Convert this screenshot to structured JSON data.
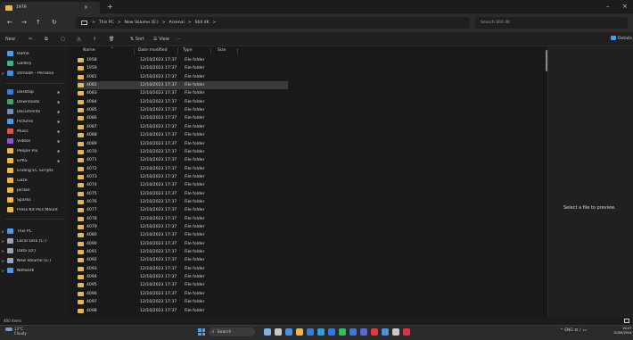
{
  "window": {
    "tab_title": "1979",
    "tab_close": "×",
    "tab_new": "+",
    "min": "–",
    "close": "×"
  },
  "nav": {
    "back": "←",
    "forward": "→",
    "up": "↑",
    "refresh": "↻"
  },
  "address": {
    "sep": ">",
    "crumbs": [
      "This PC",
      "New Volume (E:)",
      "Arsenal",
      "Still 4K"
    ]
  },
  "search": {
    "placeholder": "Search Still 4K"
  },
  "commands": {
    "new": "New",
    "sort": "Sort",
    "view": "View",
    "more": "···",
    "details": "Details"
  },
  "sidebar": {
    "items": [
      {
        "label": "Home",
        "icon": "home-icon",
        "color": "#4c9be8",
        "pinned": false,
        "chevron": ""
      },
      {
        "label": "Gallery",
        "icon": "gallery-icon",
        "color": "#3fb08a",
        "pinned": false,
        "chevron": ""
      },
      {
        "label": "shmooh - Persona",
        "icon": "cloud-icon",
        "color": "#3b8ed8",
        "pinned": false,
        "chevron": ">"
      },
      {
        "label": "Desktop",
        "icon": "desktop-icon",
        "color": "#3a7bd5",
        "pinned": true,
        "chevron": ""
      },
      {
        "label": "Downloads",
        "icon": "download-icon",
        "color": "#3fa36b",
        "pinned": true,
        "chevron": ""
      },
      {
        "label": "Documents",
        "icon": "document-icon",
        "color": "#6c8fb8",
        "pinned": true,
        "chevron": ""
      },
      {
        "label": "Pictures",
        "icon": "pictures-icon",
        "color": "#4c9be8",
        "pinned": true,
        "chevron": ""
      },
      {
        "label": "Music",
        "icon": "music-icon",
        "color": "#e0573d",
        "pinned": true,
        "chevron": ""
      },
      {
        "label": "Videos",
        "icon": "video-icon",
        "color": "#8a5bd6",
        "pinned": true,
        "chevron": ""
      },
      {
        "label": "People Pix",
        "icon": "folder-icon",
        "color": "#e8b84a",
        "pinned": true,
        "chevron": ""
      },
      {
        "label": "EPKS",
        "icon": "folder-icon",
        "color": "#e8b84a",
        "pinned": true,
        "chevron": ""
      },
      {
        "label": "Ending EC Scripts",
        "icon": "folder-icon",
        "color": "#e8b84a",
        "pinned": false,
        "chevron": ""
      },
      {
        "label": "Gaze",
        "icon": "folder-icon",
        "color": "#e8b84a",
        "pinned": false,
        "chevron": ""
      },
      {
        "label": "Jordan",
        "icon": "folder-icon",
        "color": "#e8b84a",
        "pinned": false,
        "chevron": ""
      },
      {
        "label": "Sparks",
        "icon": "folder-icon",
        "color": "#e8b84a",
        "pinned": false,
        "chevron": ""
      },
      {
        "label": "Press Kit Pics Mount",
        "icon": "folder-icon",
        "color": "#e8b84a",
        "pinned": false,
        "chevron": ""
      },
      {
        "label": "This PC",
        "icon": "pc-icon",
        "color": "#4c9be8",
        "pinned": false,
        "chevron": "v"
      },
      {
        "label": "Local Disk (C:)",
        "icon": "drive-icon",
        "color": "#9aa4b2",
        "pinned": false,
        "chevron": ">"
      },
      {
        "label": "Data (D:)",
        "icon": "drive-icon",
        "color": "#9aa4b2",
        "pinned": false,
        "chevron": ">"
      },
      {
        "label": "New Volume (E:)",
        "icon": "drive-icon",
        "color": "#9aa4b2",
        "pinned": false,
        "chevron": ">"
      },
      {
        "label": "Network",
        "icon": "network-icon",
        "color": "#4c9be8",
        "pinned": false,
        "chevron": ">"
      }
    ]
  },
  "columns": {
    "name": "Name",
    "date": "Date modified",
    "type": "Type",
    "size": "Size"
  },
  "files": [
    {
      "name": "1958",
      "date": "12/10/2023 17:37",
      "type": "File folder"
    },
    {
      "name": "1959",
      "date": "12/10/2023 17:37",
      "type": "File folder"
    },
    {
      "name": "4081",
      "date": "12/10/2023 17:37",
      "type": "File folder"
    },
    {
      "name": "4082",
      "date": "12/10/2023 17:37",
      "type": "File folder",
      "selected": true
    },
    {
      "name": "4083",
      "date": "12/10/2023 17:37",
      "type": "File folder"
    },
    {
      "name": "4084",
      "date": "12/10/2023 17:37",
      "type": "File folder"
    },
    {
      "name": "4085",
      "date": "12/10/2023 17:37",
      "type": "File folder"
    },
    {
      "name": "4086",
      "date": "12/10/2023 17:37",
      "type": "File folder"
    },
    {
      "name": "4087",
      "date": "12/10/2023 17:37",
      "type": "File folder"
    },
    {
      "name": "4088",
      "date": "12/10/2023 17:37",
      "type": "File folder"
    },
    {
      "name": "4089",
      "date": "12/10/2023 17:37",
      "type": "File folder"
    },
    {
      "name": "4070",
      "date": "12/10/2023 17:37",
      "type": "File folder"
    },
    {
      "name": "4071",
      "date": "12/10/2023 17:37",
      "type": "File folder"
    },
    {
      "name": "4072",
      "date": "12/10/2023 17:37",
      "type": "File folder"
    },
    {
      "name": "4073",
      "date": "12/10/2023 17:37",
      "type": "File folder"
    },
    {
      "name": "4074",
      "date": "12/10/2023 17:37",
      "type": "File folder"
    },
    {
      "name": "4075",
      "date": "12/10/2023 17:37",
      "type": "File folder"
    },
    {
      "name": "4076",
      "date": "12/10/2023 17:37",
      "type": "File folder"
    },
    {
      "name": "4077",
      "date": "12/10/2023 17:37",
      "type": "File folder"
    },
    {
      "name": "4078",
      "date": "12/10/2023 17:37",
      "type": "File folder"
    },
    {
      "name": "4079",
      "date": "12/10/2023 17:37",
      "type": "File folder"
    },
    {
      "name": "4080",
      "date": "12/10/2023 17:37",
      "type": "File folder"
    },
    {
      "name": "4090",
      "date": "12/10/2023 17:37",
      "type": "File folder"
    },
    {
      "name": "4091",
      "date": "12/10/2023 17:37",
      "type": "File folder"
    },
    {
      "name": "4092",
      "date": "12/10/2023 17:37",
      "type": "File folder"
    },
    {
      "name": "4093",
      "date": "12/10/2023 17:37",
      "type": "File folder"
    },
    {
      "name": "4094",
      "date": "12/10/2023 17:37",
      "type": "File folder"
    },
    {
      "name": "4095",
      "date": "12/10/2023 17:37",
      "type": "File folder"
    },
    {
      "name": "4096",
      "date": "12/10/2023 17:37",
      "type": "File folder"
    },
    {
      "name": "4097",
      "date": "12/10/2023 17:37",
      "type": "File folder"
    },
    {
      "name": "4098",
      "date": "12/10/2023 17:37",
      "type": "File folder"
    }
  ],
  "preview": {
    "message": "Select a file to preview."
  },
  "status": {
    "items": "400 items"
  },
  "taskbar": {
    "weather_temp": "13°C",
    "weather_desc": "Cloudy",
    "search": "Search",
    "apps": [
      {
        "icon": "copilot-icon",
        "color": "#7fb0e0"
      },
      {
        "icon": "task-view-icon",
        "color": "#c8c8c8"
      },
      {
        "icon": "chrome-icon",
        "color": "#4a8fe0"
      },
      {
        "icon": "file-explorer-icon",
        "color": "#e8b84a"
      },
      {
        "icon": "store-icon",
        "color": "#3a7bd5"
      },
      {
        "icon": "edge-icon",
        "color": "#2fa0d8"
      },
      {
        "icon": "photoshop-icon",
        "color": "#2c7be0"
      },
      {
        "icon": "spotify-icon",
        "color": "#2ec060"
      },
      {
        "icon": "outlook-icon",
        "color": "#3a7bd5"
      },
      {
        "icon": "app-icon",
        "color": "#5a6ad8"
      },
      {
        "icon": "netflix-icon",
        "color": "#e03a3a"
      },
      {
        "icon": "app-icon",
        "color": "#4a8fe0"
      },
      {
        "icon": "app-icon",
        "color": "#c8c8c8"
      },
      {
        "icon": "app-icon",
        "color": "#e0304a"
      }
    ],
    "tray": "^  ENG  ⊡  ♪  ▭",
    "time": "20:47",
    "date": "10/09/2024"
  }
}
